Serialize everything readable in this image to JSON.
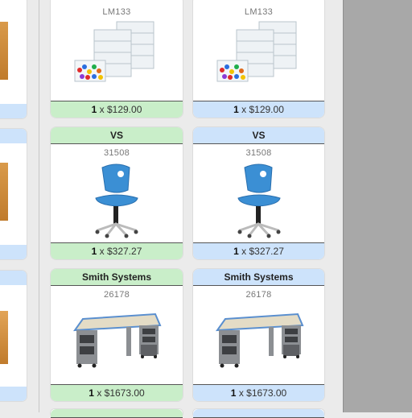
{
  "cards": [
    {
      "col": "left",
      "brand": "",
      "sku": "LM133",
      "qty": "1",
      "sep": "x",
      "price": "$129.00",
      "theme": "green"
    },
    {
      "col": "right",
      "brand": "",
      "sku": "LM133",
      "qty": "1",
      "sep": "x",
      "price": "$129.00",
      "theme": "blue"
    },
    {
      "col": "left",
      "brand": "VS",
      "sku": "31508",
      "qty": "1",
      "sep": "x",
      "price": "$327.27",
      "theme": "green"
    },
    {
      "col": "right",
      "brand": "VS",
      "sku": "31508",
      "qty": "1",
      "sep": "x",
      "price": "$327.27",
      "theme": "blue"
    },
    {
      "col": "left",
      "brand": "Smith Systems",
      "sku": "26178",
      "qty": "1",
      "sep": "x",
      "price": "$1673.00",
      "theme": "green"
    },
    {
      "col": "right",
      "brand": "Smith Systems",
      "sku": "26178",
      "qty": "1",
      "sep": "x",
      "price": "$1673.00",
      "theme": "blue"
    }
  ],
  "images": {
    "bins": "storage-bins-image",
    "chair": "task-chair-image",
    "desk": "teacher-desk-image"
  },
  "colors": {
    "green_band": "#c9eec9",
    "blue_band": "#cde3fb",
    "panel_gray": "#a8a8a8",
    "background": "#ebebeb"
  }
}
